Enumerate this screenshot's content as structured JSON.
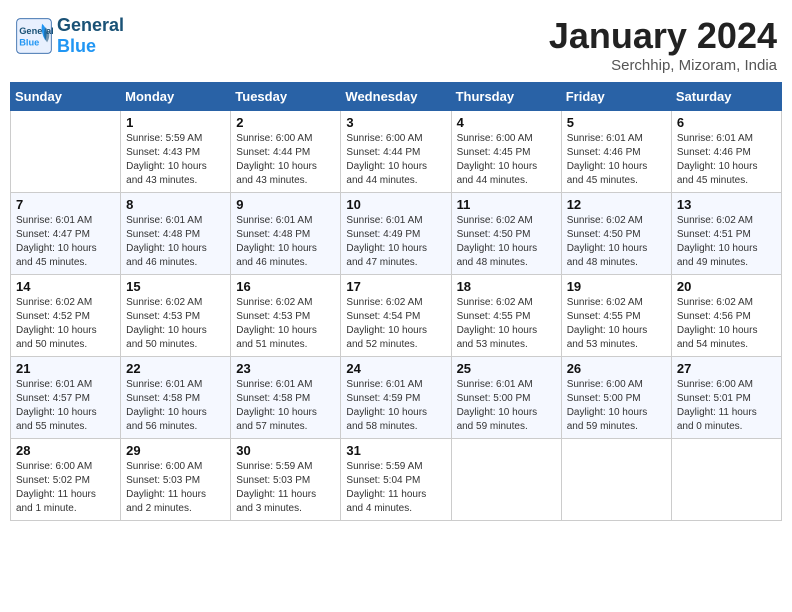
{
  "header": {
    "logo_line1": "General",
    "logo_line2": "Blue",
    "main_title": "January 2024",
    "subtitle": "Serchhip, Mizoram, India"
  },
  "calendar": {
    "weekdays": [
      "Sunday",
      "Monday",
      "Tuesday",
      "Wednesday",
      "Thursday",
      "Friday",
      "Saturday"
    ],
    "weeks": [
      [
        {
          "day": "",
          "info": ""
        },
        {
          "day": "1",
          "info": "Sunrise: 5:59 AM\nSunset: 4:43 PM\nDaylight: 10 hours\nand 43 minutes."
        },
        {
          "day": "2",
          "info": "Sunrise: 6:00 AM\nSunset: 4:44 PM\nDaylight: 10 hours\nand 43 minutes."
        },
        {
          "day": "3",
          "info": "Sunrise: 6:00 AM\nSunset: 4:44 PM\nDaylight: 10 hours\nand 44 minutes."
        },
        {
          "day": "4",
          "info": "Sunrise: 6:00 AM\nSunset: 4:45 PM\nDaylight: 10 hours\nand 44 minutes."
        },
        {
          "day": "5",
          "info": "Sunrise: 6:01 AM\nSunset: 4:46 PM\nDaylight: 10 hours\nand 45 minutes."
        },
        {
          "day": "6",
          "info": "Sunrise: 6:01 AM\nSunset: 4:46 PM\nDaylight: 10 hours\nand 45 minutes."
        }
      ],
      [
        {
          "day": "7",
          "info": "Sunrise: 6:01 AM\nSunset: 4:47 PM\nDaylight: 10 hours\nand 45 minutes."
        },
        {
          "day": "8",
          "info": "Sunrise: 6:01 AM\nSunset: 4:48 PM\nDaylight: 10 hours\nand 46 minutes."
        },
        {
          "day": "9",
          "info": "Sunrise: 6:01 AM\nSunset: 4:48 PM\nDaylight: 10 hours\nand 46 minutes."
        },
        {
          "day": "10",
          "info": "Sunrise: 6:01 AM\nSunset: 4:49 PM\nDaylight: 10 hours\nand 47 minutes."
        },
        {
          "day": "11",
          "info": "Sunrise: 6:02 AM\nSunset: 4:50 PM\nDaylight: 10 hours\nand 48 minutes."
        },
        {
          "day": "12",
          "info": "Sunrise: 6:02 AM\nSunset: 4:50 PM\nDaylight: 10 hours\nand 48 minutes."
        },
        {
          "day": "13",
          "info": "Sunrise: 6:02 AM\nSunset: 4:51 PM\nDaylight: 10 hours\nand 49 minutes."
        }
      ],
      [
        {
          "day": "14",
          "info": "Sunrise: 6:02 AM\nSunset: 4:52 PM\nDaylight: 10 hours\nand 50 minutes."
        },
        {
          "day": "15",
          "info": "Sunrise: 6:02 AM\nSunset: 4:53 PM\nDaylight: 10 hours\nand 50 minutes."
        },
        {
          "day": "16",
          "info": "Sunrise: 6:02 AM\nSunset: 4:53 PM\nDaylight: 10 hours\nand 51 minutes."
        },
        {
          "day": "17",
          "info": "Sunrise: 6:02 AM\nSunset: 4:54 PM\nDaylight: 10 hours\nand 52 minutes."
        },
        {
          "day": "18",
          "info": "Sunrise: 6:02 AM\nSunset: 4:55 PM\nDaylight: 10 hours\nand 53 minutes."
        },
        {
          "day": "19",
          "info": "Sunrise: 6:02 AM\nSunset: 4:55 PM\nDaylight: 10 hours\nand 53 minutes."
        },
        {
          "day": "20",
          "info": "Sunrise: 6:02 AM\nSunset: 4:56 PM\nDaylight: 10 hours\nand 54 minutes."
        }
      ],
      [
        {
          "day": "21",
          "info": "Sunrise: 6:01 AM\nSunset: 4:57 PM\nDaylight: 10 hours\nand 55 minutes."
        },
        {
          "day": "22",
          "info": "Sunrise: 6:01 AM\nSunset: 4:58 PM\nDaylight: 10 hours\nand 56 minutes."
        },
        {
          "day": "23",
          "info": "Sunrise: 6:01 AM\nSunset: 4:58 PM\nDaylight: 10 hours\nand 57 minutes."
        },
        {
          "day": "24",
          "info": "Sunrise: 6:01 AM\nSunset: 4:59 PM\nDaylight: 10 hours\nand 58 minutes."
        },
        {
          "day": "25",
          "info": "Sunrise: 6:01 AM\nSunset: 5:00 PM\nDaylight: 10 hours\nand 59 minutes."
        },
        {
          "day": "26",
          "info": "Sunrise: 6:00 AM\nSunset: 5:00 PM\nDaylight: 10 hours\nand 59 minutes."
        },
        {
          "day": "27",
          "info": "Sunrise: 6:00 AM\nSunset: 5:01 PM\nDaylight: 11 hours\nand 0 minutes."
        }
      ],
      [
        {
          "day": "28",
          "info": "Sunrise: 6:00 AM\nSunset: 5:02 PM\nDaylight: 11 hours\nand 1 minute."
        },
        {
          "day": "29",
          "info": "Sunrise: 6:00 AM\nSunset: 5:03 PM\nDaylight: 11 hours\nand 2 minutes."
        },
        {
          "day": "30",
          "info": "Sunrise: 5:59 AM\nSunset: 5:03 PM\nDaylight: 11 hours\nand 3 minutes."
        },
        {
          "day": "31",
          "info": "Sunrise: 5:59 AM\nSunset: 5:04 PM\nDaylight: 11 hours\nand 4 minutes."
        },
        {
          "day": "",
          "info": ""
        },
        {
          "day": "",
          "info": ""
        },
        {
          "day": "",
          "info": ""
        }
      ]
    ]
  }
}
